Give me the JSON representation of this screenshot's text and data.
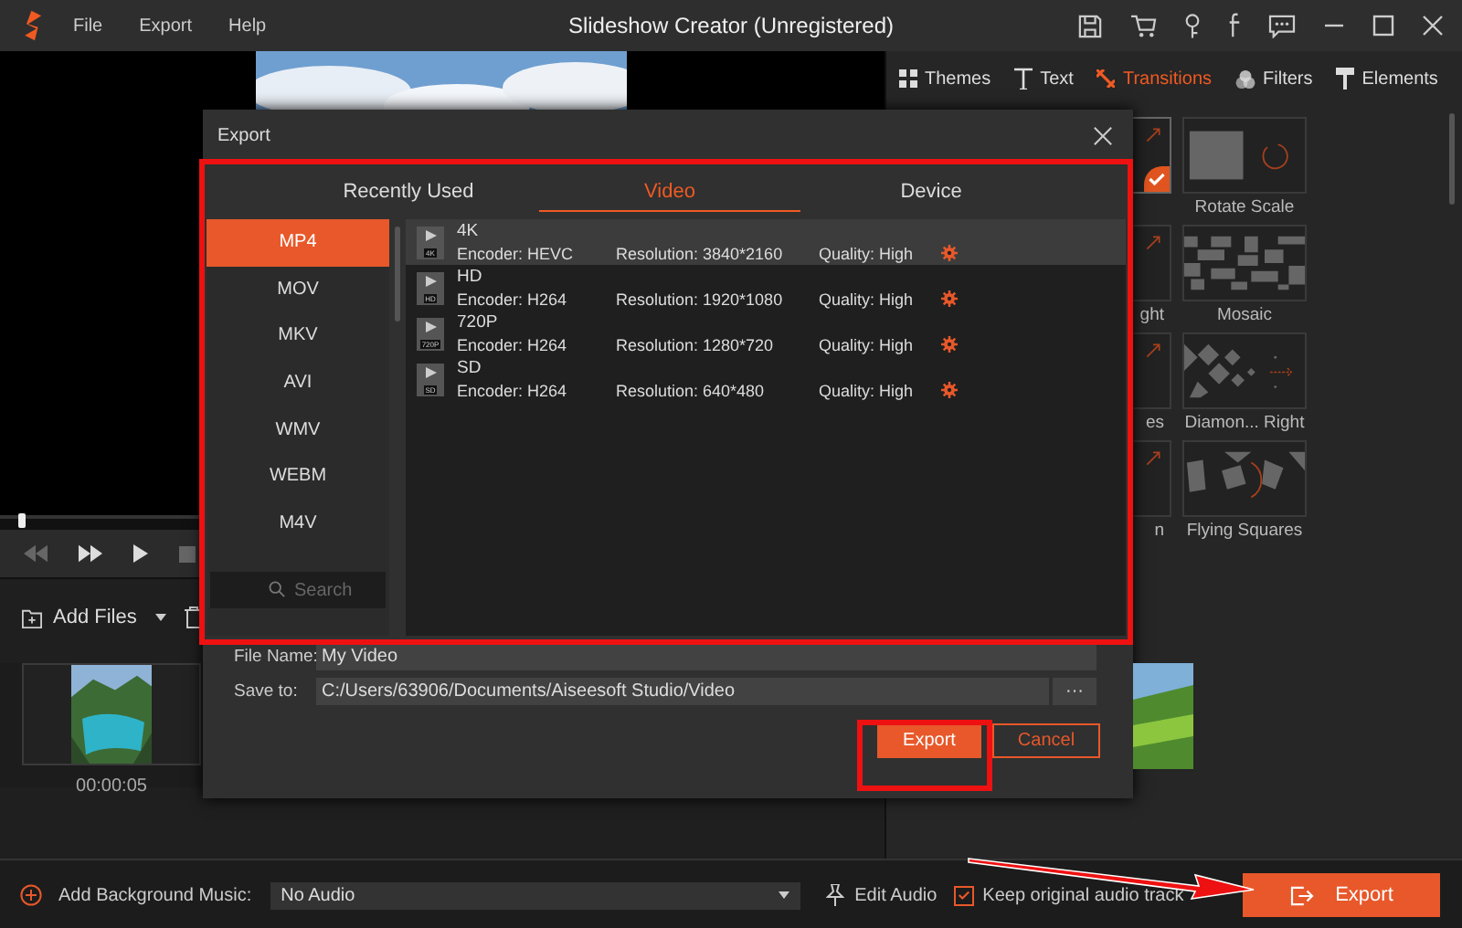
{
  "window": {
    "title": "Slideshow Creator (Unregistered)",
    "menu": [
      "File",
      "Export",
      "Help"
    ]
  },
  "right_panel": {
    "tabs": [
      {
        "label": "Themes",
        "selected": false
      },
      {
        "label": "Text",
        "selected": false
      },
      {
        "label": "Transitions",
        "selected": true
      },
      {
        "label": "Filters",
        "selected": false
      },
      {
        "label": "Elements",
        "selected": false
      }
    ],
    "transitions": [
      {
        "kind": "partial",
        "selected": true
      },
      {
        "kind": "scale",
        "label": "Rotate Scale",
        "selected": false
      },
      {
        "kind": "partial",
        "label": "ght",
        "selected": false
      },
      {
        "kind": "mosaic",
        "label": "Mosaic",
        "selected": false
      },
      {
        "kind": "partial",
        "label": "es",
        "selected": false
      },
      {
        "kind": "diamond",
        "label": "Diamon... Right",
        "selected": false
      },
      {
        "kind": "partial",
        "label": "n",
        "selected": false
      },
      {
        "kind": "squares",
        "label": "Flying Squares",
        "selected": false
      }
    ]
  },
  "player": {
    "progress": {
      "level": 0.02
    }
  },
  "media": {
    "add_files": "Add Files",
    "clips": [
      {
        "duration": "00:00:05"
      }
    ]
  },
  "dialog": {
    "title": "Export",
    "tabs": [
      {
        "label": "Recently Used",
        "selected": false
      },
      {
        "label": "Video",
        "selected": true
      },
      {
        "label": "Device",
        "selected": false
      }
    ],
    "formats": [
      {
        "label": "MP4",
        "selected": true
      },
      {
        "label": "MOV",
        "selected": false
      },
      {
        "label": "MKV",
        "selected": false
      },
      {
        "label": "AVI",
        "selected": false
      },
      {
        "label": "WMV",
        "selected": false
      },
      {
        "label": "WEBM",
        "selected": false
      },
      {
        "label": "M4V",
        "selected": false
      }
    ],
    "search_placeholder": "Search",
    "presets": [
      {
        "badge": "4K",
        "name": "4K",
        "encoder": "Encoder: HEVC",
        "resolution": "Resolution: 3840*2160",
        "quality": "Quality: High",
        "selected": true
      },
      {
        "badge": "HD",
        "name": "HD",
        "encoder": "Encoder: H264",
        "resolution": "Resolution: 1920*1080",
        "quality": "Quality: High",
        "selected": false
      },
      {
        "badge": "720P",
        "name": "720P",
        "encoder": "Encoder: H264",
        "resolution": "Resolution: 1280*720",
        "quality": "Quality: High",
        "selected": false
      },
      {
        "badge": "SD",
        "name": "SD",
        "encoder": "Encoder: H264",
        "resolution": "Resolution: 640*480",
        "quality": "Quality: High",
        "selected": false
      }
    ],
    "file_name_label": "File Name:",
    "file_name": "My Video",
    "save_to_label": "Save to:",
    "save_to": "C:/Users/63906/Documents/Aiseesoft Studio/Video",
    "browse": "···",
    "export": "Export",
    "cancel": "Cancel"
  },
  "bottom_bar": {
    "music_label": "Add Background Music:",
    "music": "No Audio",
    "edit_audio": "Edit Audio",
    "keep_original": {
      "label": "Keep original audio track",
      "checked": true
    },
    "export": "Export"
  }
}
